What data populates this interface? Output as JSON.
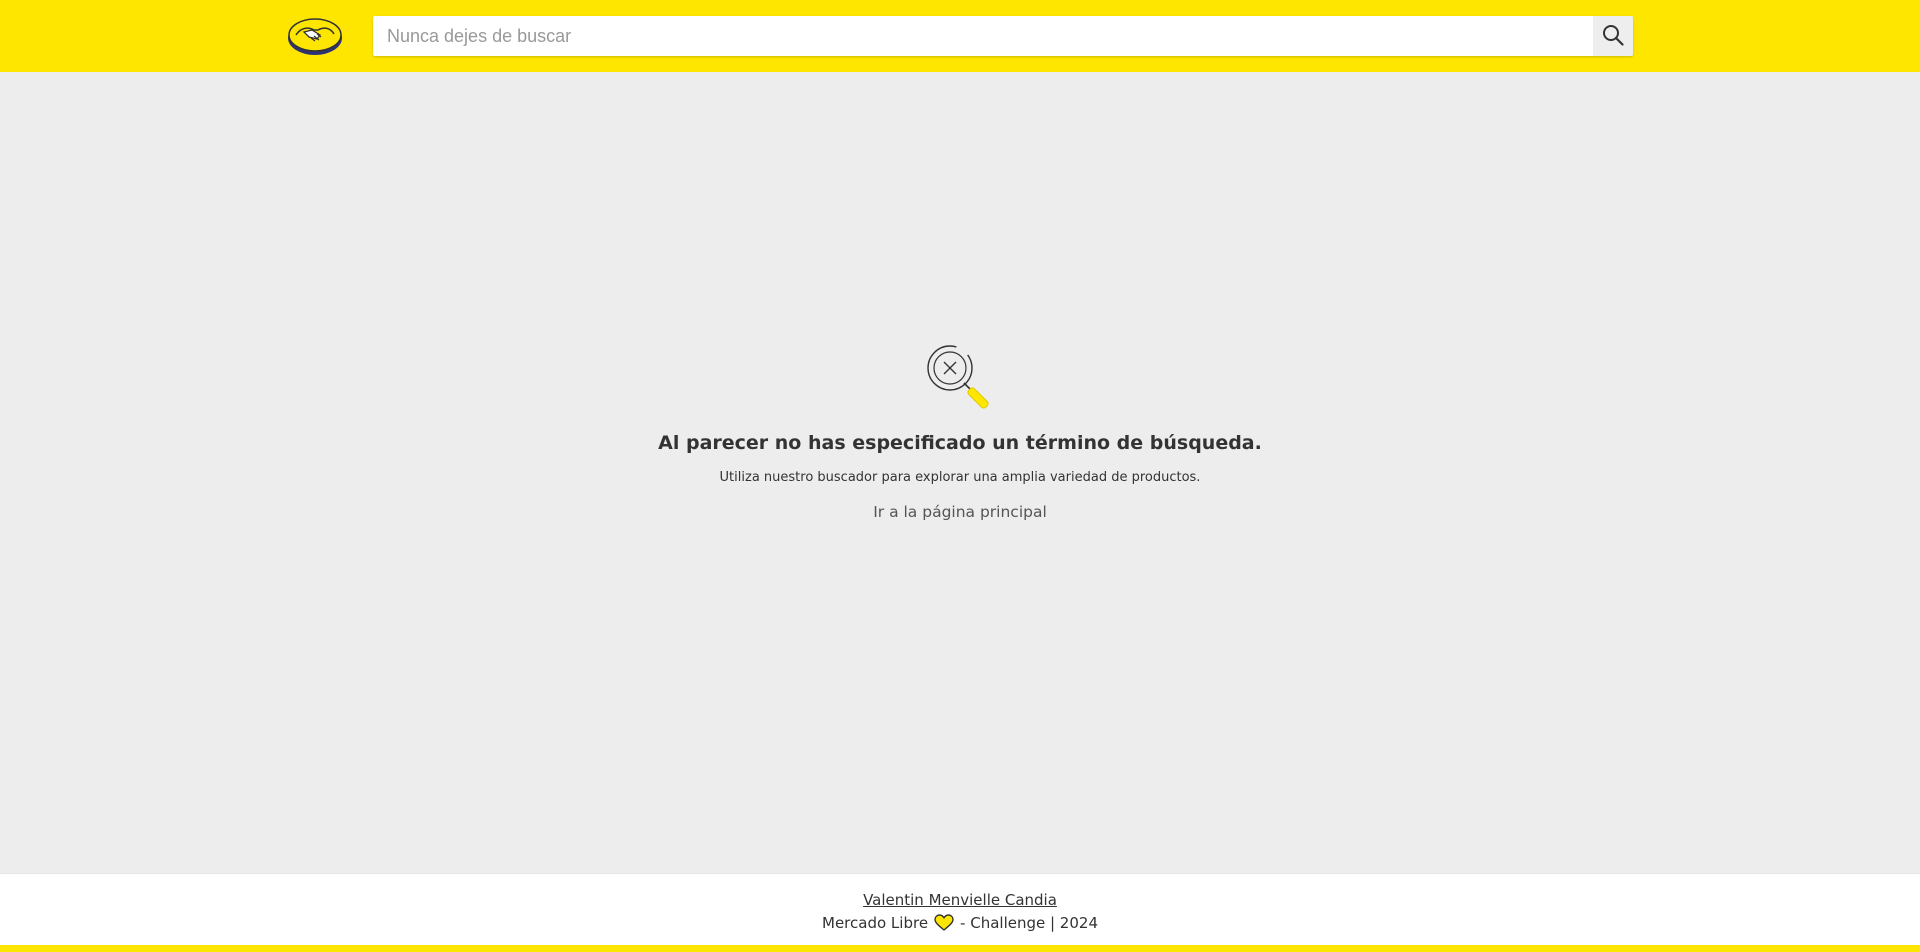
{
  "header": {
    "logo_icon": "mercadolibre-handshake-logo",
    "search": {
      "placeholder": "Nunca dejes de buscar",
      "value": "",
      "button_icon": "search-icon"
    }
  },
  "empty_state": {
    "icon": "search-no-results-icon",
    "title": "Al parecer no has especificado un término de búsqueda.",
    "subtitle": "Utiliza nuestro buscador para explorar una amplia variedad de productos.",
    "link_label": "Ir a la página principal"
  },
  "footer": {
    "author": "Valentin Menvielle Candia",
    "brand": "Mercado Libre",
    "heart_icon": "heart-icon",
    "suffix": "- Challenge | 2024"
  },
  "colors": {
    "brand_yellow": "#ffe600",
    "background": "#ededed",
    "text": "#333333"
  }
}
